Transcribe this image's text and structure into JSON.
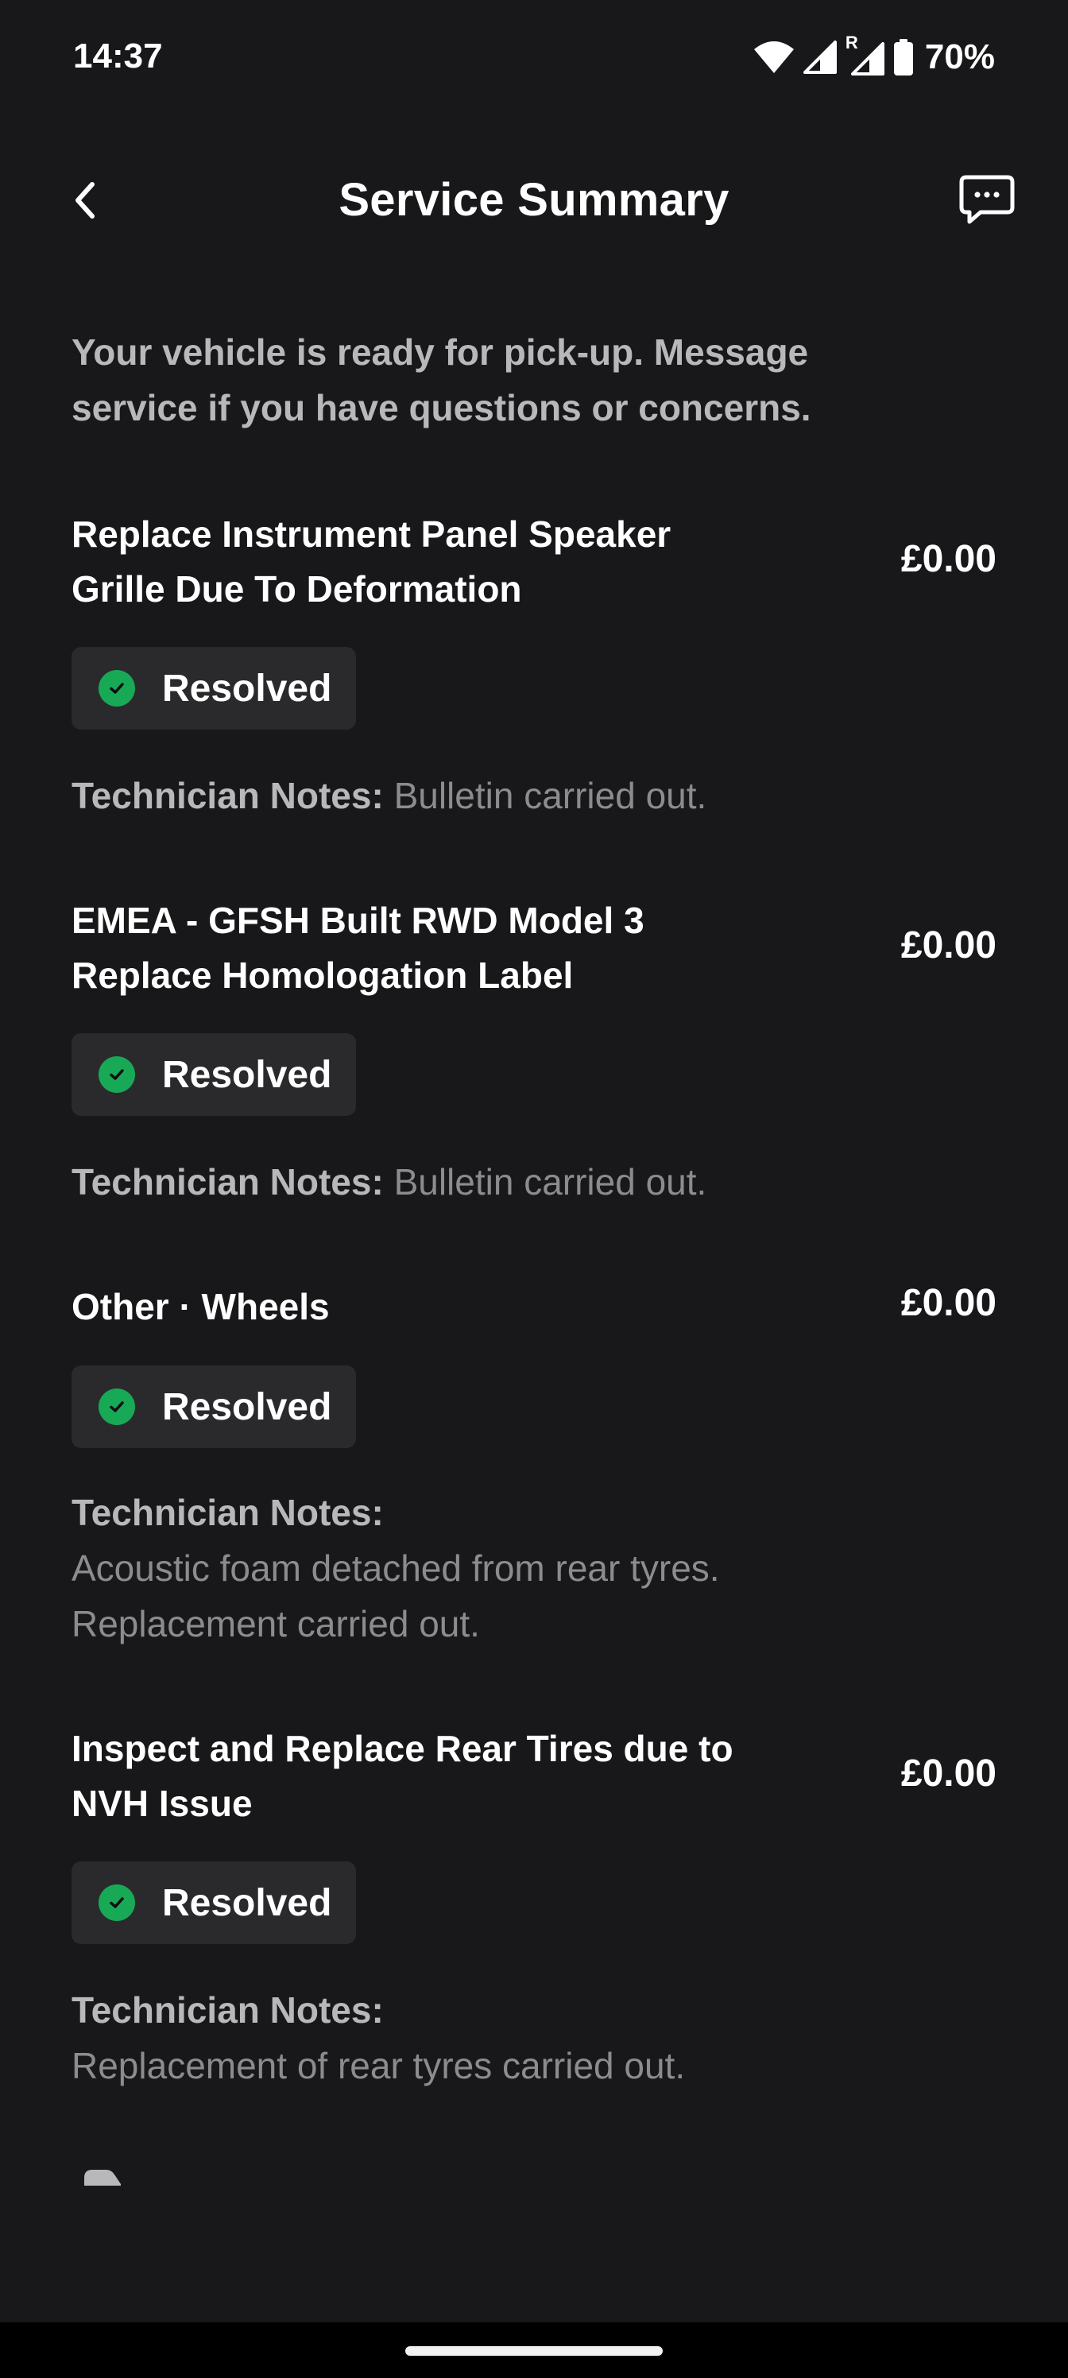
{
  "status_bar": {
    "time": "14:37",
    "roaming_indicator": "R",
    "battery_percent": "70%",
    "icons": [
      "wifi-icon",
      "signal-icon",
      "signal-roaming-icon",
      "battery-icon"
    ]
  },
  "header": {
    "title": "Service Summary",
    "back_icon": "chevron-left-icon",
    "message_icon": "chat-bubble-icon"
  },
  "intro": "Your vehicle is ready for pick-up. Message service if you have questions or concerns.",
  "colors": {
    "background": "#18181a",
    "badge_background": "#2a2a2d",
    "resolved_green": "#18a957",
    "secondary_text": "#b8b8ba",
    "tertiary_text": "#8c8c8e"
  },
  "service_items": [
    {
      "title_line1": "Replace Instrument Panel Speaker",
      "title_line2": "Grille Due To Deformation",
      "price": "£0.00",
      "status": "Resolved",
      "notes_label": "Technician Notes:",
      "notes_text": "Bulletin carried out."
    },
    {
      "title_line1": "EMEA - GFSH Built RWD Model 3",
      "title_line2": "Replace Homologation Label",
      "price": "£0.00",
      "status": "Resolved",
      "notes_label": "Technician Notes:",
      "notes_text": "Bulletin carried out."
    },
    {
      "title_line1": "Other · Wheels",
      "price": "£0.00",
      "status": "Resolved",
      "notes_label": "Technician Notes:",
      "notes_line1": "Acoustic foam detached from rear tyres.",
      "notes_line2": "Replacement carried out."
    },
    {
      "title_line1": "Inspect and Replace Rear Tires due to",
      "title_line2": "NVH Issue",
      "price": "£0.00",
      "status": "Resolved",
      "notes_label": "Technician Notes:",
      "notes_line1": "Replacement of rear tyres carried out."
    }
  ]
}
